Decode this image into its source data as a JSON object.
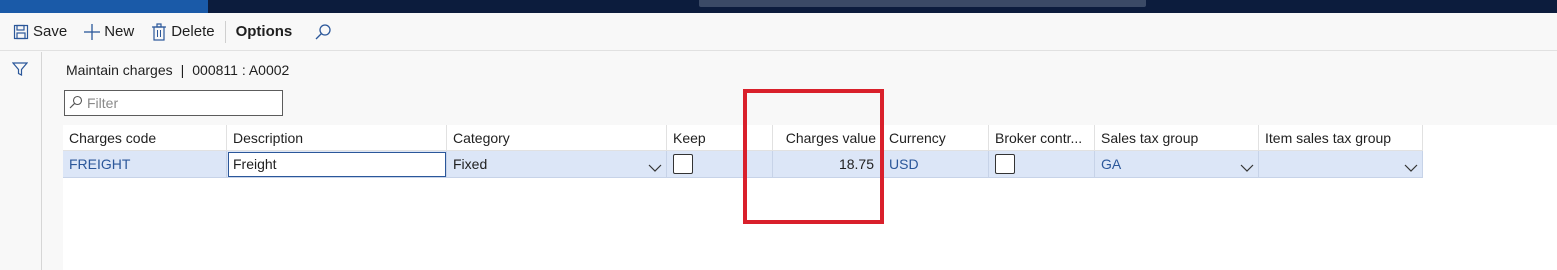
{
  "action_pane": {
    "save_label": "Save",
    "new_label": "New",
    "delete_label": "Delete",
    "options_label": "Options"
  },
  "breadcrumb": {
    "form": "Maintain charges",
    "separator": "|",
    "record": "000811 : A0002"
  },
  "filter": {
    "placeholder": "Filter"
  },
  "grid": {
    "columns": [
      "Charges code",
      "Description",
      "Category",
      "Keep",
      "Charges value",
      "Currency",
      "Broker contr...",
      "Sales tax group",
      "Item sales tax group"
    ],
    "rows": [
      {
        "charges_code": "FREIGHT",
        "description": "Freight",
        "category": "Fixed",
        "keep": false,
        "charges_value": "18.75",
        "currency": "USD",
        "broker_contract": false,
        "sales_tax_group": "GA",
        "item_sales_tax_group": ""
      }
    ]
  },
  "colors": {
    "accent": "#2b579a",
    "selected_row": "#dce6f7",
    "highlight_box": "#d9202b",
    "top_bar": "#0c1c3d"
  }
}
